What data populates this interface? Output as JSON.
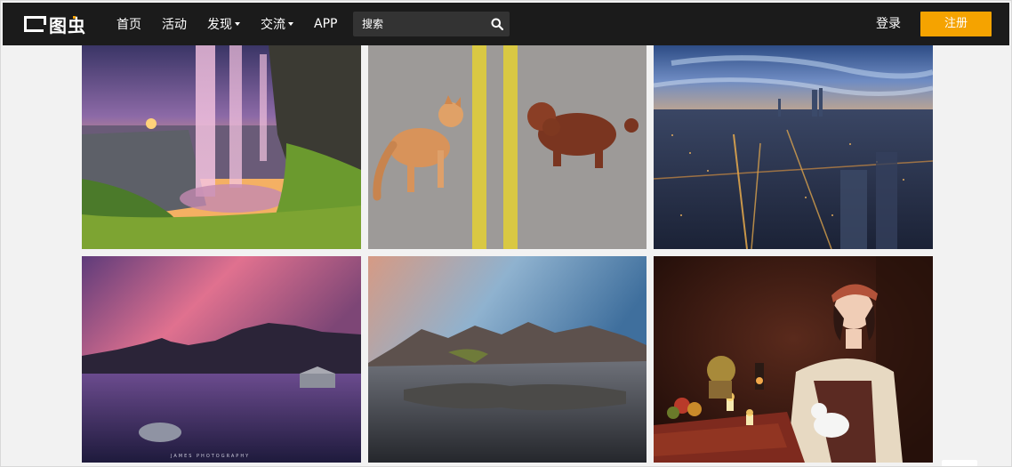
{
  "header": {
    "logo_text": "图虫",
    "nav": [
      {
        "label": "首页",
        "dropdown": false
      },
      {
        "label": "活动",
        "dropdown": false
      },
      {
        "label": "发现",
        "dropdown": true
      },
      {
        "label": "交流",
        "dropdown": true
      },
      {
        "label": "APP",
        "dropdown": false
      }
    ],
    "search": {
      "placeholder": "搜索",
      "value": ""
    },
    "login_label": "登录",
    "register_label": "注册"
  },
  "colors": {
    "navbar": "#1b1b1b",
    "accent": "#f5a300",
    "page_bg": "#f2f2f2"
  },
  "gallery": {
    "photos": [
      {
        "subject": "waterfall-at-sunset"
      },
      {
        "subject": "cat-and-poodle-on-road"
      },
      {
        "subject": "city-skyline-at-dusk"
      },
      {
        "subject": "lake-and-mountains-pink-sky"
      },
      {
        "subject": "mountain-reflection-beach"
      },
      {
        "subject": "woman-with-candles-portrait"
      }
    ],
    "watermark": "JAMES PHOTOGRAPHY"
  }
}
